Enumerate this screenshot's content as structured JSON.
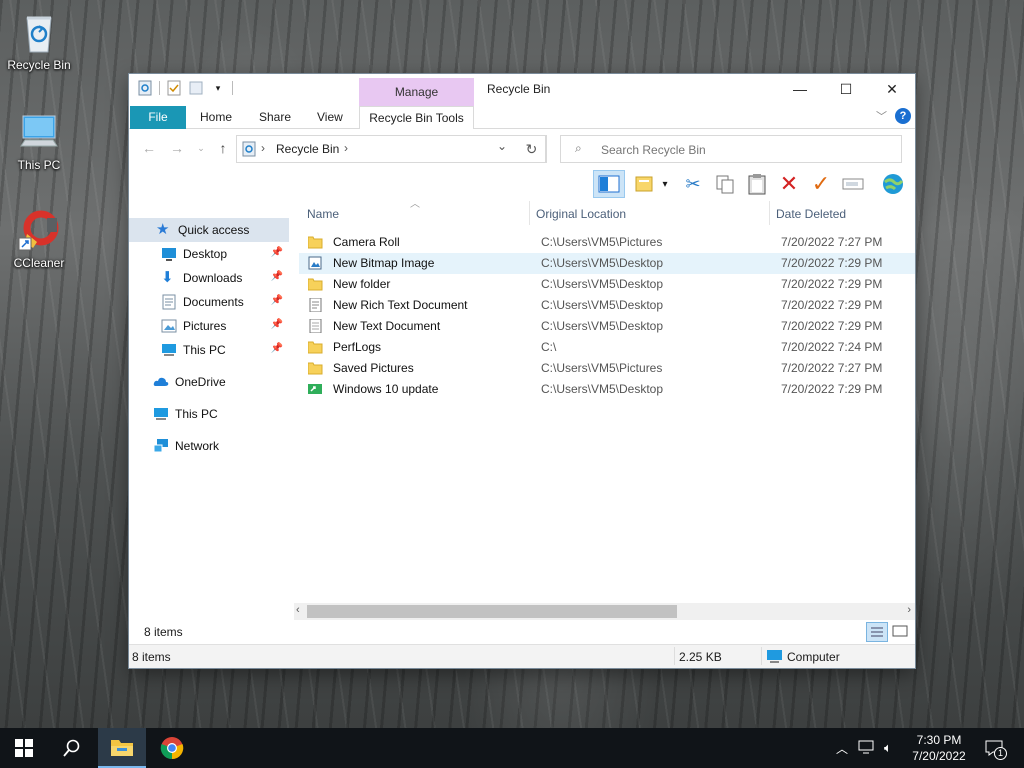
{
  "desktop": {
    "icons": [
      {
        "label": "Recycle Bin"
      },
      {
        "label": "This PC"
      },
      {
        "label": "CCleaner"
      }
    ]
  },
  "window": {
    "title": "Recycle Bin",
    "context_tab": "Manage",
    "ribbon_tabs": [
      "File",
      "Home",
      "Share",
      "View",
      "Recycle Bin Tools"
    ],
    "address": "Recycle Bin",
    "search_placeholder": "Search Recycle Bin",
    "controls": {
      "minimize": "—",
      "maximize": "☐",
      "close": "✕"
    }
  },
  "sidebar": {
    "items": [
      {
        "label": "Quick access",
        "icon": "star-icon",
        "selected": true
      },
      {
        "label": "Desktop",
        "icon": "desktop-icon",
        "pinned": true
      },
      {
        "label": "Downloads",
        "icon": "downloads-icon",
        "pinned": true
      },
      {
        "label": "Documents",
        "icon": "documents-icon",
        "pinned": true
      },
      {
        "label": "Pictures",
        "icon": "pictures-icon",
        "pinned": true
      },
      {
        "label": "This PC",
        "icon": "computer-icon",
        "pinned": true
      },
      {
        "label": "OneDrive",
        "icon": "cloud-icon"
      },
      {
        "label": "This PC",
        "icon": "computer-icon"
      },
      {
        "label": "Network",
        "icon": "network-icon"
      }
    ]
  },
  "columns": [
    "Name",
    "Original Location",
    "Date Deleted"
  ],
  "files": [
    {
      "name": "Camera Roll",
      "location": "C:\\Users\\VM5\\Pictures",
      "date": "7/20/2022 7:27 PM",
      "icon": "folder-icon"
    },
    {
      "name": "New Bitmap Image",
      "location": "C:\\Users\\VM5\\Desktop",
      "date": "7/20/2022 7:29 PM",
      "icon": "bitmap-icon",
      "highlighted": true
    },
    {
      "name": "New folder",
      "location": "C:\\Users\\VM5\\Desktop",
      "date": "7/20/2022 7:29 PM",
      "icon": "folder-icon"
    },
    {
      "name": "New Rich Text Document",
      "location": "C:\\Users\\VM5\\Desktop",
      "date": "7/20/2022 7:29 PM",
      "icon": "rtf-icon"
    },
    {
      "name": "New Text Document",
      "location": "C:\\Users\\VM5\\Desktop",
      "date": "7/20/2022 7:29 PM",
      "icon": "text-doc-icon"
    },
    {
      "name": "PerfLogs",
      "location": "C:\\",
      "date": "7/20/2022 7:24 PM",
      "icon": "folder-icon"
    },
    {
      "name": "Saved Pictures",
      "location": "C:\\Users\\VM5\\Pictures",
      "date": "7/20/2022 7:27 PM",
      "icon": "folder-icon"
    },
    {
      "name": "Windows 10 update",
      "location": "C:\\Users\\VM5\\Desktop",
      "date": "7/20/2022 7:29 PM",
      "icon": "shortcut-icon"
    }
  ],
  "detail": {
    "count": "8 items"
  },
  "status": {
    "count": "8 items",
    "size": "2.25 KB",
    "location": "Computer"
  },
  "taskbar": {
    "time": "7:30 PM",
    "date": "7/20/2022",
    "notification_count": "1"
  },
  "colors": {
    "accent": "#1a97b5",
    "manage_tab": "#e8c8f2",
    "selection": "#dbe4ee",
    "hover_row": "#e5f3fb",
    "taskbar": "#101418"
  }
}
